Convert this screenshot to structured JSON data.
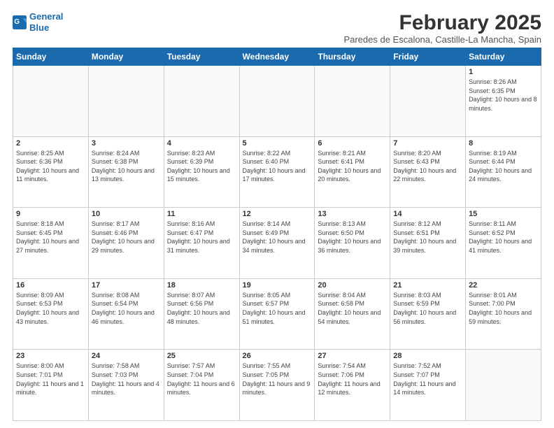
{
  "logo": {
    "line1": "General",
    "line2": "Blue"
  },
  "title": "February 2025",
  "subtitle": "Paredes de Escalona, Castille-La Mancha, Spain",
  "days_of_week": [
    "Sunday",
    "Monday",
    "Tuesday",
    "Wednesday",
    "Thursday",
    "Friday",
    "Saturday"
  ],
  "weeks": [
    [
      {
        "day": "",
        "info": ""
      },
      {
        "day": "",
        "info": ""
      },
      {
        "day": "",
        "info": ""
      },
      {
        "day": "",
        "info": ""
      },
      {
        "day": "",
        "info": ""
      },
      {
        "day": "",
        "info": ""
      },
      {
        "day": "1",
        "info": "Sunrise: 8:26 AM\nSunset: 6:35 PM\nDaylight: 10 hours and 8 minutes."
      }
    ],
    [
      {
        "day": "2",
        "info": "Sunrise: 8:25 AM\nSunset: 6:36 PM\nDaylight: 10 hours and 11 minutes."
      },
      {
        "day": "3",
        "info": "Sunrise: 8:24 AM\nSunset: 6:38 PM\nDaylight: 10 hours and 13 minutes."
      },
      {
        "day": "4",
        "info": "Sunrise: 8:23 AM\nSunset: 6:39 PM\nDaylight: 10 hours and 15 minutes."
      },
      {
        "day": "5",
        "info": "Sunrise: 8:22 AM\nSunset: 6:40 PM\nDaylight: 10 hours and 17 minutes."
      },
      {
        "day": "6",
        "info": "Sunrise: 8:21 AM\nSunset: 6:41 PM\nDaylight: 10 hours and 20 minutes."
      },
      {
        "day": "7",
        "info": "Sunrise: 8:20 AM\nSunset: 6:43 PM\nDaylight: 10 hours and 22 minutes."
      },
      {
        "day": "8",
        "info": "Sunrise: 8:19 AM\nSunset: 6:44 PM\nDaylight: 10 hours and 24 minutes."
      }
    ],
    [
      {
        "day": "9",
        "info": "Sunrise: 8:18 AM\nSunset: 6:45 PM\nDaylight: 10 hours and 27 minutes."
      },
      {
        "day": "10",
        "info": "Sunrise: 8:17 AM\nSunset: 6:46 PM\nDaylight: 10 hours and 29 minutes."
      },
      {
        "day": "11",
        "info": "Sunrise: 8:16 AM\nSunset: 6:47 PM\nDaylight: 10 hours and 31 minutes."
      },
      {
        "day": "12",
        "info": "Sunrise: 8:14 AM\nSunset: 6:49 PM\nDaylight: 10 hours and 34 minutes."
      },
      {
        "day": "13",
        "info": "Sunrise: 8:13 AM\nSunset: 6:50 PM\nDaylight: 10 hours and 36 minutes."
      },
      {
        "day": "14",
        "info": "Sunrise: 8:12 AM\nSunset: 6:51 PM\nDaylight: 10 hours and 39 minutes."
      },
      {
        "day": "15",
        "info": "Sunrise: 8:11 AM\nSunset: 6:52 PM\nDaylight: 10 hours and 41 minutes."
      }
    ],
    [
      {
        "day": "16",
        "info": "Sunrise: 8:09 AM\nSunset: 6:53 PM\nDaylight: 10 hours and 43 minutes."
      },
      {
        "day": "17",
        "info": "Sunrise: 8:08 AM\nSunset: 6:54 PM\nDaylight: 10 hours and 46 minutes."
      },
      {
        "day": "18",
        "info": "Sunrise: 8:07 AM\nSunset: 6:56 PM\nDaylight: 10 hours and 48 minutes."
      },
      {
        "day": "19",
        "info": "Sunrise: 8:05 AM\nSunset: 6:57 PM\nDaylight: 10 hours and 51 minutes."
      },
      {
        "day": "20",
        "info": "Sunrise: 8:04 AM\nSunset: 6:58 PM\nDaylight: 10 hours and 54 minutes."
      },
      {
        "day": "21",
        "info": "Sunrise: 8:03 AM\nSunset: 6:59 PM\nDaylight: 10 hours and 56 minutes."
      },
      {
        "day": "22",
        "info": "Sunrise: 8:01 AM\nSunset: 7:00 PM\nDaylight: 10 hours and 59 minutes."
      }
    ],
    [
      {
        "day": "23",
        "info": "Sunrise: 8:00 AM\nSunset: 7:01 PM\nDaylight: 11 hours and 1 minute."
      },
      {
        "day": "24",
        "info": "Sunrise: 7:58 AM\nSunset: 7:03 PM\nDaylight: 11 hours and 4 minutes."
      },
      {
        "day": "25",
        "info": "Sunrise: 7:57 AM\nSunset: 7:04 PM\nDaylight: 11 hours and 6 minutes."
      },
      {
        "day": "26",
        "info": "Sunrise: 7:55 AM\nSunset: 7:05 PM\nDaylight: 11 hours and 9 minutes."
      },
      {
        "day": "27",
        "info": "Sunrise: 7:54 AM\nSunset: 7:06 PM\nDaylight: 11 hours and 12 minutes."
      },
      {
        "day": "28",
        "info": "Sunrise: 7:52 AM\nSunset: 7:07 PM\nDaylight: 11 hours and 14 minutes."
      },
      {
        "day": "",
        "info": ""
      }
    ]
  ]
}
